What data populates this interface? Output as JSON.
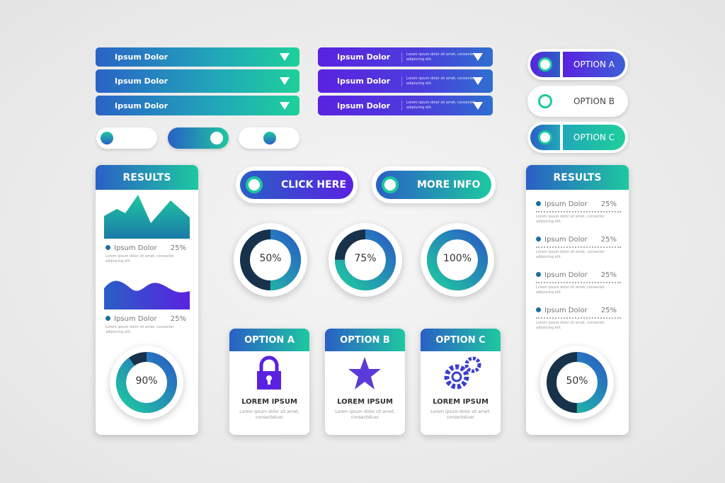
{
  "dropdowns_a": [
    {
      "label": "Ipsum Dolor"
    },
    {
      "label": "Ipsum Dolor"
    },
    {
      "label": "Ipsum Dolor"
    }
  ],
  "dropdowns_b": [
    {
      "label": "Ipsum Dolor",
      "desc": "Lorem ipsum dolor sit amet, consectet adipiscing elit."
    },
    {
      "label": "Ipsum Dolor",
      "desc": "Lorem ipsum dolor sit amet, consectet adipiscing elit."
    },
    {
      "label": "Ipsum Dolor",
      "desc": "Lorem ipsum dolor sit amet, consectet adipiscing elit."
    }
  ],
  "toggles": [
    {
      "state": "off"
    },
    {
      "state": "on"
    },
    {
      "state": "mid"
    }
  ],
  "options": [
    {
      "label": "OPTION A",
      "selected": true
    },
    {
      "label": "OPTION B",
      "selected": false
    },
    {
      "label": "OPTION C",
      "selected": true
    }
  ],
  "buttons": {
    "click_here": "CLICK HERE",
    "more_info": "MORE INFO"
  },
  "gauges": [
    {
      "label": "50%",
      "value": 50
    },
    {
      "label": "75%",
      "value": 75
    },
    {
      "label": "100%",
      "value": 100
    }
  ],
  "results_left": {
    "title": "RESULTS",
    "items": [
      {
        "label": "Ipsum Dolor",
        "pct": "25%",
        "desc": "Lorem ipsum dolor sit amet, consectet adipiscing elit."
      },
      {
        "label": "Ipsum Dolor",
        "pct": "25%",
        "desc": "Lorem ipsum dolor sit amet, consectet adipiscing elit."
      }
    ],
    "gauge": {
      "label": "90%",
      "value": 90
    }
  },
  "results_right": {
    "title": "RESULTS",
    "items": [
      {
        "label": "Ipsum Dolor",
        "pct": "25%",
        "desc": "Lorem ipsum dolor sit amet, consectet adipiscing elit."
      },
      {
        "label": "Ipsum Dolor",
        "pct": "25%",
        "desc": "Lorem ipsum dolor sit amet, consectet adipiscing elit."
      },
      {
        "label": "Ipsum Dolor",
        "pct": "25%",
        "desc": "Lorem ipsum dolor sit amet, consectet adipiscing elit."
      },
      {
        "label": "Ipsum Dolor",
        "pct": "25%",
        "desc": "Lorem ipsum dolor sit amet, consectet adipiscing elit."
      }
    ],
    "gauge": {
      "label": "50%",
      "value": 50
    }
  },
  "option_cards": [
    {
      "title": "OPTION A",
      "icon": "lock-icon",
      "heading": "LOREM IPSUM",
      "desc": "Lorem ipsum dolor sit amet, consectetuer"
    },
    {
      "title": "OPTION B",
      "icon": "star-icon",
      "heading": "LOREM IPSUM",
      "desc": "Lorem ipsum dolor sit amet, consectetuer"
    },
    {
      "title": "OPTION C",
      "icon": "gears-icon",
      "heading": "LOREM IPSUM",
      "desc": "Lorem ipsum dolor sit amet, consectetuer"
    }
  ],
  "colors": {
    "teal": "#1ec8a0",
    "blue": "#2a5fc6",
    "purple": "#5a22e0"
  }
}
